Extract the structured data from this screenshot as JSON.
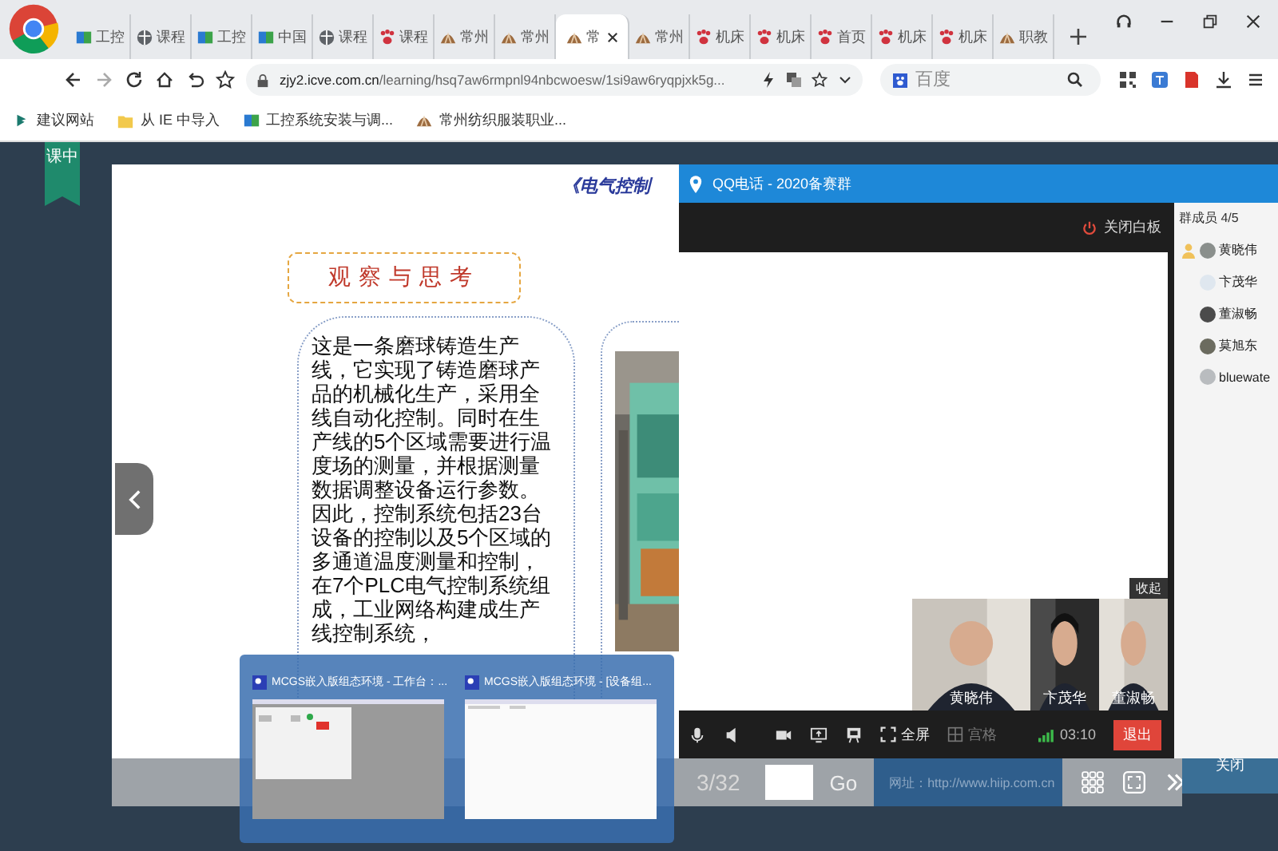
{
  "browser": {
    "tabs": [
      {
        "label": "工控",
        "selected": false
      },
      {
        "label": "课程",
        "selected": false
      },
      {
        "label": "工控",
        "selected": false
      },
      {
        "label": "中国",
        "selected": false
      },
      {
        "label": "课程",
        "selected": false
      },
      {
        "label": "课程",
        "selected": false
      },
      {
        "label": "常州",
        "selected": false
      },
      {
        "label": "常州",
        "selected": false
      },
      {
        "label": "常",
        "selected": true
      },
      {
        "label": "常州",
        "selected": false
      },
      {
        "label": "机床",
        "selected": false
      },
      {
        "label": "机床",
        "selected": false
      },
      {
        "label": "首页",
        "selected": false
      },
      {
        "label": "机床",
        "selected": false
      },
      {
        "label": "机床",
        "selected": false
      },
      {
        "label": "职教",
        "selected": false
      }
    ],
    "address": {
      "host": "zjy2.icve.com.cn",
      "path": "/learning/hsq7aw6rmpnl94nbcwoesw/1si9aw6ryqpjxk5g..."
    },
    "search": {
      "placeholder": "百度"
    },
    "bookmarks": [
      {
        "label": "建议网站"
      },
      {
        "label": "从 IE 中导入"
      },
      {
        "label": "工控系统安装与调..."
      },
      {
        "label": "常州纺织服装职业..."
      }
    ]
  },
  "slide": {
    "ribbon": "课中",
    "header": "《电气控制",
    "heading": "观察与思考",
    "paragraph": "这是一条磨球铸造生产线，它实现了铸造磨球产品的机械化生产，采用全线自动化控制。同时在生产线的5个区域需要进行温度场的测量，并根据测量数据调整设备运行参数。因此，控制系统包括23台设备的控制以及5个区域的多通道温度测量和控制，在7个PLC电气控制系统组成，工业网络构建成生产线控制系统，"
  },
  "player": {
    "page": "3/32",
    "go": "Go",
    "url": "网址：http://www.hiip.com.cn",
    "close": "关闭"
  },
  "qq": {
    "title": "QQ电话 - 2020备赛群",
    "close_whiteboard": "关闭白板",
    "members_header": "群成员 4/5",
    "members": [
      {
        "name": "黄晓伟",
        "owner": true
      },
      {
        "name": "卞茂华",
        "owner": false
      },
      {
        "name": "董淑畅",
        "owner": false
      },
      {
        "name": "莫旭东",
        "owner": false
      },
      {
        "name": "bluewate",
        "owner": false
      }
    ],
    "collapse": "收起",
    "videos": [
      {
        "name": "黄晓伟"
      },
      {
        "name": "卞茂华"
      },
      {
        "name": "董淑畅"
      }
    ],
    "controls": [
      {
        "kind": "mic"
      },
      {
        "kind": "speaker"
      },
      {
        "kind": "camera"
      },
      {
        "kind": "share"
      },
      {
        "kind": "board"
      },
      {
        "kind": "text",
        "label": "全屏",
        "disabled": false
      },
      {
        "kind": "text",
        "label": "宫格",
        "disabled": true
      }
    ],
    "timer": "03:10",
    "exit": "退出"
  },
  "taskbar_preview": {
    "items": [
      {
        "title": "MCGS嵌入版组态环境 - 工作台：..."
      },
      {
        "title": "MCGS嵌入版组态环境 - [设备组..."
      }
    ]
  }
}
